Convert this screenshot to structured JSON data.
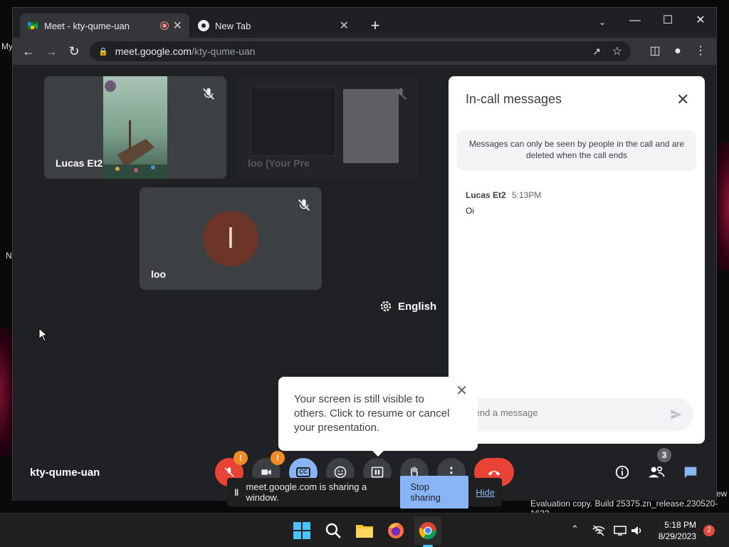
{
  "desktop": {
    "edge_texts": [
      "My",
      "N"
    ],
    "eval_text": "Evaluation copy. Build 25375.zn_release.230520-1632",
    "edge_text_right": "ew"
  },
  "browser": {
    "tabs": [
      {
        "title": "Meet - kty-qume-uan",
        "active": true
      },
      {
        "title": "New Tab",
        "active": false
      }
    ],
    "url_host": "meet.google.com",
    "url_path": "/kty-qume-uan"
  },
  "tiles": [
    {
      "name": "Lucas Et2",
      "muted": true
    },
    {
      "name": "loo (Your Pre",
      "muted": true
    },
    {
      "name": "loo",
      "initial": "l",
      "muted": true
    }
  ],
  "captions_language": "English",
  "panel": {
    "title": "In-call messages",
    "notice": "Messages can only be seen by people in the call and are deleted when the call ends",
    "messages": [
      {
        "sender": "Lucas Et2",
        "time": "5:13PM",
        "text": "Oi"
      }
    ],
    "compose_placeholder": "Send a message"
  },
  "popup": {
    "text": "Your screen is still visible to others. Click to resume or cancel your presentation."
  },
  "meeting_code": "kty-qume-uan",
  "controls": {
    "mic_badge": "!",
    "camera_badge": "!",
    "people_count": "3"
  },
  "share_bar": {
    "text": "meet.google.com is sharing a window.",
    "stop_label": "Stop sharing",
    "hide_label": "Hide"
  },
  "taskbar": {
    "time": "5:18 PM",
    "date": "8/29/2023",
    "notifications": "2"
  },
  "colors": {
    "end_call": "#ea4335",
    "accent": "#8ab4f8",
    "cc_active": "#8ab4f8"
  }
}
